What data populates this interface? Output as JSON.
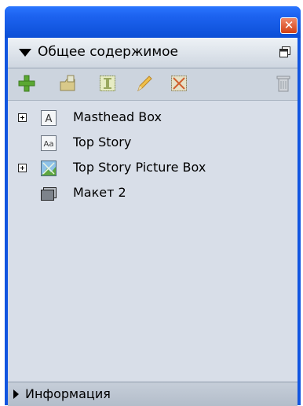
{
  "window": {
    "close_icon": "close-icon",
    "close_label": "✕"
  },
  "header": {
    "title": "Общее содержимое",
    "menu_icon": "panel-menu-icon"
  },
  "toolbar": {
    "buttons": [
      {
        "icon": "add-icon"
      },
      {
        "icon": "import-icon"
      },
      {
        "icon": "text-box-icon"
      },
      {
        "icon": "edit-pencil-icon"
      },
      {
        "icon": "picture-box-icon"
      },
      {
        "icon": "trash-icon"
      }
    ]
  },
  "tree": {
    "items": [
      {
        "label": "Masthead Box",
        "icon": "text-box-a-icon",
        "expandable": true
      },
      {
        "label": "Top Story",
        "icon": "story-aa-icon",
        "expandable": false
      },
      {
        "label": "Top Story Picture Box",
        "icon": "picture-box-icon",
        "expandable": true
      },
      {
        "label": "Макет 2",
        "icon": "layout-icon",
        "expandable": false
      }
    ]
  },
  "footer": {
    "label": "Информация"
  },
  "colors": {
    "titlebar": "#1d63f0",
    "panel_bg": "#d8dee8",
    "close_button": "#d23f14"
  }
}
